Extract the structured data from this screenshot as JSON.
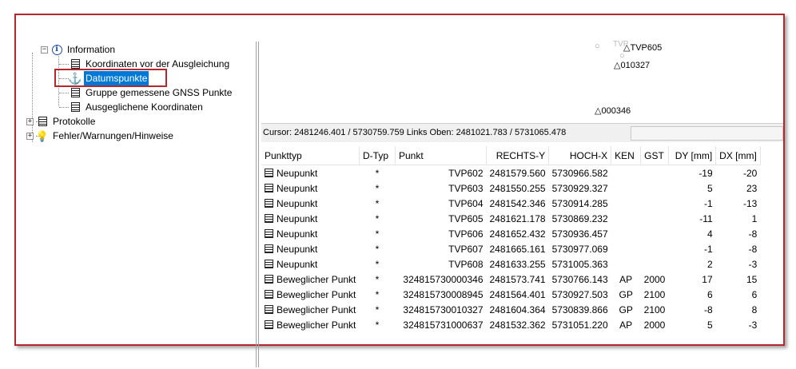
{
  "tree": {
    "information": "Information",
    "koordinaten_vor": "Koordinaten vor der Ausgleichung",
    "datumspunkte": "Datumspunkte",
    "gruppe_gnss": "Gruppe gemessene GNSS Punkte",
    "ausgeglichene": "Ausgeglichene Koordinaten",
    "protokolle": "Protokolle",
    "fehler": "Fehler/Warnungen/Hinweise",
    "expander_expanded": "−",
    "expander_collapsed": "+"
  },
  "graphic": {
    "points": [
      "TVP605",
      "010327",
      "000346"
    ]
  },
  "status": {
    "cursor_text": "Cursor: 2481246.401 / 5730759.759 Links Oben: 2481021.783 / 5731065.478"
  },
  "table": {
    "headers": {
      "punkttyp": "Punkttyp",
      "dtyp": "D-Typ",
      "punkt": "Punkt",
      "rechts": "RECHTS-Y",
      "hoch": "HOCH-X",
      "ken": "KEN",
      "gst": "GST",
      "dy": "DY [mm]",
      "dx": "DX [mm]"
    },
    "rows": [
      {
        "typ": "Neupunkt",
        "dtyp": "*",
        "punkt": "TVP602",
        "rechts": "2481579.560",
        "hoch": "5730966.582",
        "ken": "",
        "gst": "",
        "dy": "-19",
        "dx": "-20"
      },
      {
        "typ": "Neupunkt",
        "dtyp": "*",
        "punkt": "TVP603",
        "rechts": "2481550.255",
        "hoch": "5730929.327",
        "ken": "",
        "gst": "",
        "dy": "5",
        "dx": "23"
      },
      {
        "typ": "Neupunkt",
        "dtyp": "*",
        "punkt": "TVP604",
        "rechts": "2481542.346",
        "hoch": "5730914.285",
        "ken": "",
        "gst": "",
        "dy": "-1",
        "dx": "-13"
      },
      {
        "typ": "Neupunkt",
        "dtyp": "*",
        "punkt": "TVP605",
        "rechts": "2481621.178",
        "hoch": "5730869.232",
        "ken": "",
        "gst": "",
        "dy": "-11",
        "dx": "1"
      },
      {
        "typ": "Neupunkt",
        "dtyp": "*",
        "punkt": "TVP606",
        "rechts": "2481652.432",
        "hoch": "5730936.457",
        "ken": "",
        "gst": "",
        "dy": "4",
        "dx": "-8"
      },
      {
        "typ": "Neupunkt",
        "dtyp": "*",
        "punkt": "TVP607",
        "rechts": "2481665.161",
        "hoch": "5730977.069",
        "ken": "",
        "gst": "",
        "dy": "-1",
        "dx": "-8"
      },
      {
        "typ": "Neupunkt",
        "dtyp": "*",
        "punkt": "TVP608",
        "rechts": "2481633.255",
        "hoch": "5731005.363",
        "ken": "",
        "gst": "",
        "dy": "2",
        "dx": "-3"
      },
      {
        "typ": "Beweglicher Punkt",
        "dtyp": "*",
        "punkt": "324815730000346",
        "rechts": "2481573.741",
        "hoch": "5730766.143",
        "ken": "AP",
        "gst": "2000",
        "dy": "17",
        "dx": "15"
      },
      {
        "typ": "Beweglicher Punkt",
        "dtyp": "*",
        "punkt": "324815730008945",
        "rechts": "2481564.401",
        "hoch": "5730927.503",
        "ken": "GP",
        "gst": "2100",
        "dy": "6",
        "dx": "6"
      },
      {
        "typ": "Beweglicher Punkt",
        "dtyp": "*",
        "punkt": "324815730010327",
        "rechts": "2481604.364",
        "hoch": "5730839.866",
        "ken": "GP",
        "gst": "2100",
        "dy": "-8",
        "dx": "8"
      },
      {
        "typ": "Beweglicher Punkt",
        "dtyp": "*",
        "punkt": "324815731000637",
        "rechts": "2481532.362",
        "hoch": "5731051.220",
        "ken": "AP",
        "gst": "2000",
        "dy": "5",
        "dx": "-3"
      }
    ]
  },
  "colors": {
    "highlight_border": "#b3282d",
    "selection": "#0078d7"
  }
}
